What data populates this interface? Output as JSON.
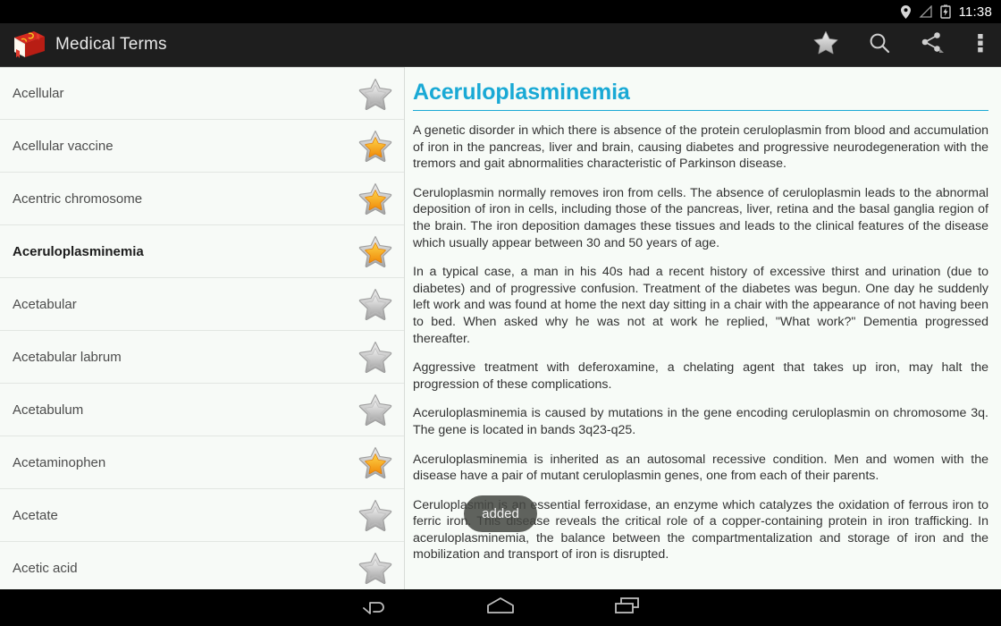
{
  "statusbar": {
    "time": "11:38",
    "icons": [
      "location-pin-icon",
      "signal-icon",
      "battery-charging-icon"
    ]
  },
  "actionbar": {
    "app_icon": "book-icon",
    "title": "Medical Terms",
    "actions": [
      {
        "name": "favorites-button",
        "icon": "star-icon"
      },
      {
        "name": "search-button",
        "icon": "search-icon"
      },
      {
        "name": "share-button",
        "icon": "share-icon"
      },
      {
        "name": "overflow-menu-button",
        "icon": "more-vertical-icon"
      }
    ]
  },
  "list": {
    "items": [
      {
        "label": "Acellular",
        "favorite": false,
        "selected": false
      },
      {
        "label": "Acellular vaccine",
        "favorite": true,
        "selected": false
      },
      {
        "label": "Acentric chromosome",
        "favorite": true,
        "selected": false
      },
      {
        "label": "Aceruloplasminemia",
        "favorite": true,
        "selected": true
      },
      {
        "label": "Acetabular",
        "favorite": false,
        "selected": false
      },
      {
        "label": "Acetabular labrum",
        "favorite": false,
        "selected": false
      },
      {
        "label": "Acetabulum",
        "favorite": false,
        "selected": false
      },
      {
        "label": "Acetaminophen",
        "favorite": true,
        "selected": false
      },
      {
        "label": "Acetate",
        "favorite": false,
        "selected": false
      },
      {
        "label": "Acetic acid",
        "favorite": false,
        "selected": false
      }
    ]
  },
  "detail": {
    "title": "Aceruloplasminemia",
    "paragraphs": [
      "A genetic disorder in which there is absence of the protein ceruloplasmin from blood and accumulation of iron in the pancreas, liver and brain, causing diabetes and progressive neurodegeneration with the tremors and gait abnormalities characteristic of Parkinson disease.",
      "Ceruloplasmin normally removes iron from cells. The absence of ceruloplasmin leads to the abnormal deposition of iron in cells, including those of the pancreas, liver, retina and the basal ganglia region of the brain. The iron deposition damages these tissues and leads to the clinical features of the disease which usually appear between 30 and 50 years of age.",
      "In a typical case, a man in his 40s had a recent history of excessive thirst and urination (due to diabetes) and of progressive confusion. Treatment of the diabetes was begun. One day he suddenly left work and was found at home the next day sitting in a chair with the appearance of not having been to bed. When asked why he was not at work he replied, \"What work?\" Dementia progressed thereafter.",
      "Aggressive treatment with deferoxamine, a chelating agent that takes up iron, may halt the progression of these complications.",
      "Aceruloplasminemia is caused by mutations in the gene encoding ceruloplasmin on chromosome 3q. The gene is located in bands 3q23-q25.",
      "Aceruloplasminemia is inherited as an autosomal recessive condition. Men and women with the disease have a pair of mutant ceruloplasmin genes, one from each of their parents.",
      "Ceruloplasmin is an essential ferroxidase, an enzyme which catalyzes the oxidation of ferrous iron to ferric iron. This disease reveals the critical role of a copper-containing protein in iron trafficking. In aceruloplasminemia, the balance between the compartmentalization and storage of iron and the mobilization and transport of iron is disrupted."
    ]
  },
  "toast": {
    "message": "added"
  },
  "navbar": {
    "buttons": [
      {
        "name": "back-button",
        "icon": "back-arrow-icon"
      },
      {
        "name": "home-button",
        "icon": "home-icon"
      },
      {
        "name": "recents-button",
        "icon": "recent-apps-icon"
      }
    ]
  },
  "colors": {
    "accent": "#19a9d5",
    "favorite_star": "#f5a623",
    "inactive_star": "#b9b9b9",
    "actionbar_bg": "#1e1e1e"
  }
}
